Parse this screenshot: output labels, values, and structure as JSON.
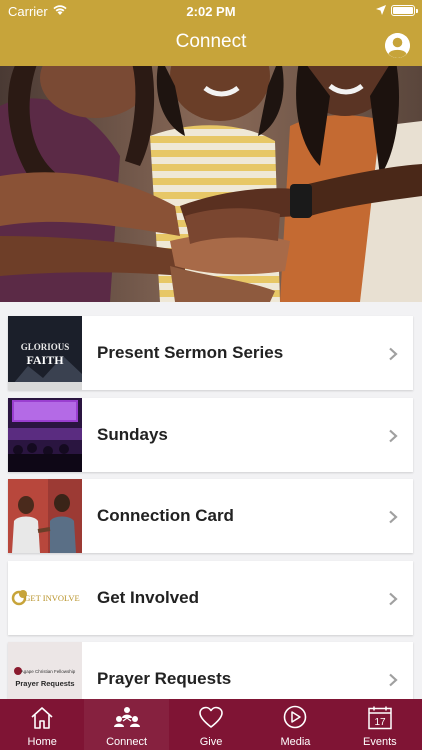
{
  "status_bar": {
    "carrier": "Carrier",
    "time": "2:02 PM"
  },
  "header": {
    "title": "Connect",
    "profile_icon": "person-circle-icon"
  },
  "hero": {
    "image": "hands-stacked-photo"
  },
  "list": {
    "items": [
      {
        "label": "Present Sermon Series",
        "thumbnail": "sermon-series-thumb",
        "thumb_text": [
          "GLORIOUS",
          "FAITH"
        ]
      },
      {
        "label": "Sundays",
        "thumbnail": "sunday-worship-thumb"
      },
      {
        "label": "Connection Card",
        "thumbnail": "connection-card-thumb"
      },
      {
        "label": "Get Involved",
        "thumbnail": "get-involved-thumb",
        "thumb_text": "GET INVOLVE"
      },
      {
        "label": "Prayer Requests",
        "thumbnail": "prayer-requests-thumb",
        "thumb_text": [
          "Agape Christian Fellowship",
          "Prayer Requests"
        ]
      }
    ]
  },
  "tab_bar": {
    "active": "Connect",
    "tabs": [
      {
        "label": "Home",
        "icon": "home-icon"
      },
      {
        "label": "Connect",
        "icon": "people-icon"
      },
      {
        "label": "Give",
        "icon": "heart-icon"
      },
      {
        "label": "Media",
        "icon": "play-icon"
      },
      {
        "label": "Events",
        "icon": "calendar-icon",
        "day": "17"
      }
    ]
  },
  "colors": {
    "header": "#c7a43a",
    "tab_bar": "#7f1434",
    "background": "#f2f2f4"
  }
}
